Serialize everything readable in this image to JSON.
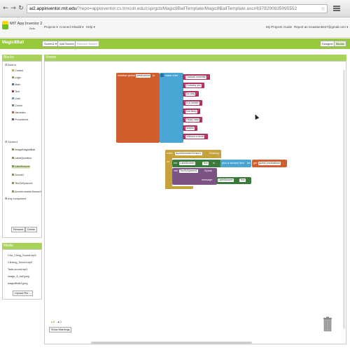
{
  "browser": {
    "url_host": "ai2.appinventor.mit.edu",
    "url_path": "/?repo=appinventor.cs.trincoll.edu/csp/gcb/Magic8BallTemplate/Magic8BallTemplate.asc#6378290835095552"
  },
  "header": {
    "brand": "MIT App Inventor 2",
    "beta": "Beta",
    "menu": [
      "Projects ▾",
      "Connect ▾",
      "Build ▾",
      "Help ▾"
    ],
    "right_links": [
      "My Projects",
      "Guide",
      "Report an Issue",
      "ram8447@gmail.com ▾"
    ]
  },
  "toolbar": {
    "project_name": "Magic8Ball",
    "screen_select": "Screen1 ▾",
    "add_screen": "Add Screen ...",
    "remove_screen": "Remove Screen",
    "designer": "Designer",
    "blocks": "Blocks"
  },
  "blocks_panel": {
    "title": "Blocks",
    "builtin_label": "Built-in",
    "builtin": [
      {
        "label": "Control",
        "color": "#e1a91a"
      },
      {
        "label": "Logic",
        "color": "#77ab41"
      },
      {
        "label": "Math",
        "color": "#3f71b5"
      },
      {
        "label": "Text",
        "color": "#b32d5e"
      },
      {
        "label": "Lists",
        "color": "#49a6d4"
      },
      {
        "label": "Colors",
        "color": "#7d7d7d"
      },
      {
        "label": "Variables",
        "color": "#d05f2d"
      },
      {
        "label": "Procedures",
        "color": "#7c5385"
      }
    ],
    "screen_label": "Screen1",
    "components": [
      "ImageMagic8Ball",
      "LabelQuestion",
      "LabelAnswer",
      "Sound1",
      "TextToSpeech1",
      "AccelerometerSensor1"
    ],
    "any_component": "Any component",
    "rename": "Rename",
    "delete": "Delete"
  },
  "media_panel": {
    "title": "Media",
    "files": [
      "Cha_Ching_Sound.mp3",
      "Clinking_Sound.mp3",
      "Tada-sound.mp3",
      "image_8_ball.jpeg",
      "magic8ball3.jpeg"
    ],
    "upload": "Upload File ..."
  },
  "viewer": {
    "title": "Viewer",
    "warnings": {
      "warning_count": "0",
      "error_count": "0"
    },
    "show_warnings": "Show Warnings"
  },
  "blocks": {
    "init_global": "initialize global",
    "var_name": "predications",
    "to": "to",
    "make_list": "make a list",
    "list_items": [
      "Outlook uncertain",
      "Probably yes",
      "No way",
      "It is certain",
      "Not likely",
      "Reply hazy",
      "Maybe",
      "Without a doubt"
    ],
    "when": "when",
    "sensor": "AccelerometerSensor1",
    "shaking": ".Shaking",
    "do": "do",
    "set": "set",
    "label_answer": "LabelAnswer",
    "text_prop": "Text",
    "to2": "to",
    "pick_random": "pick a random item",
    "list": "list",
    "get": "get",
    "global_var": "global predications",
    "call": "call",
    "tts": "TextToSpeech1",
    "speak": ".Speak",
    "message": "message"
  },
  "colors": {
    "green": "#98c93c",
    "variables": "#d05f2d",
    "lists": "#49a6d4",
    "text": "#b32d5e",
    "events": "#c6a23d",
    "components": "#3a7a3a",
    "procedures": "#7c5385"
  }
}
